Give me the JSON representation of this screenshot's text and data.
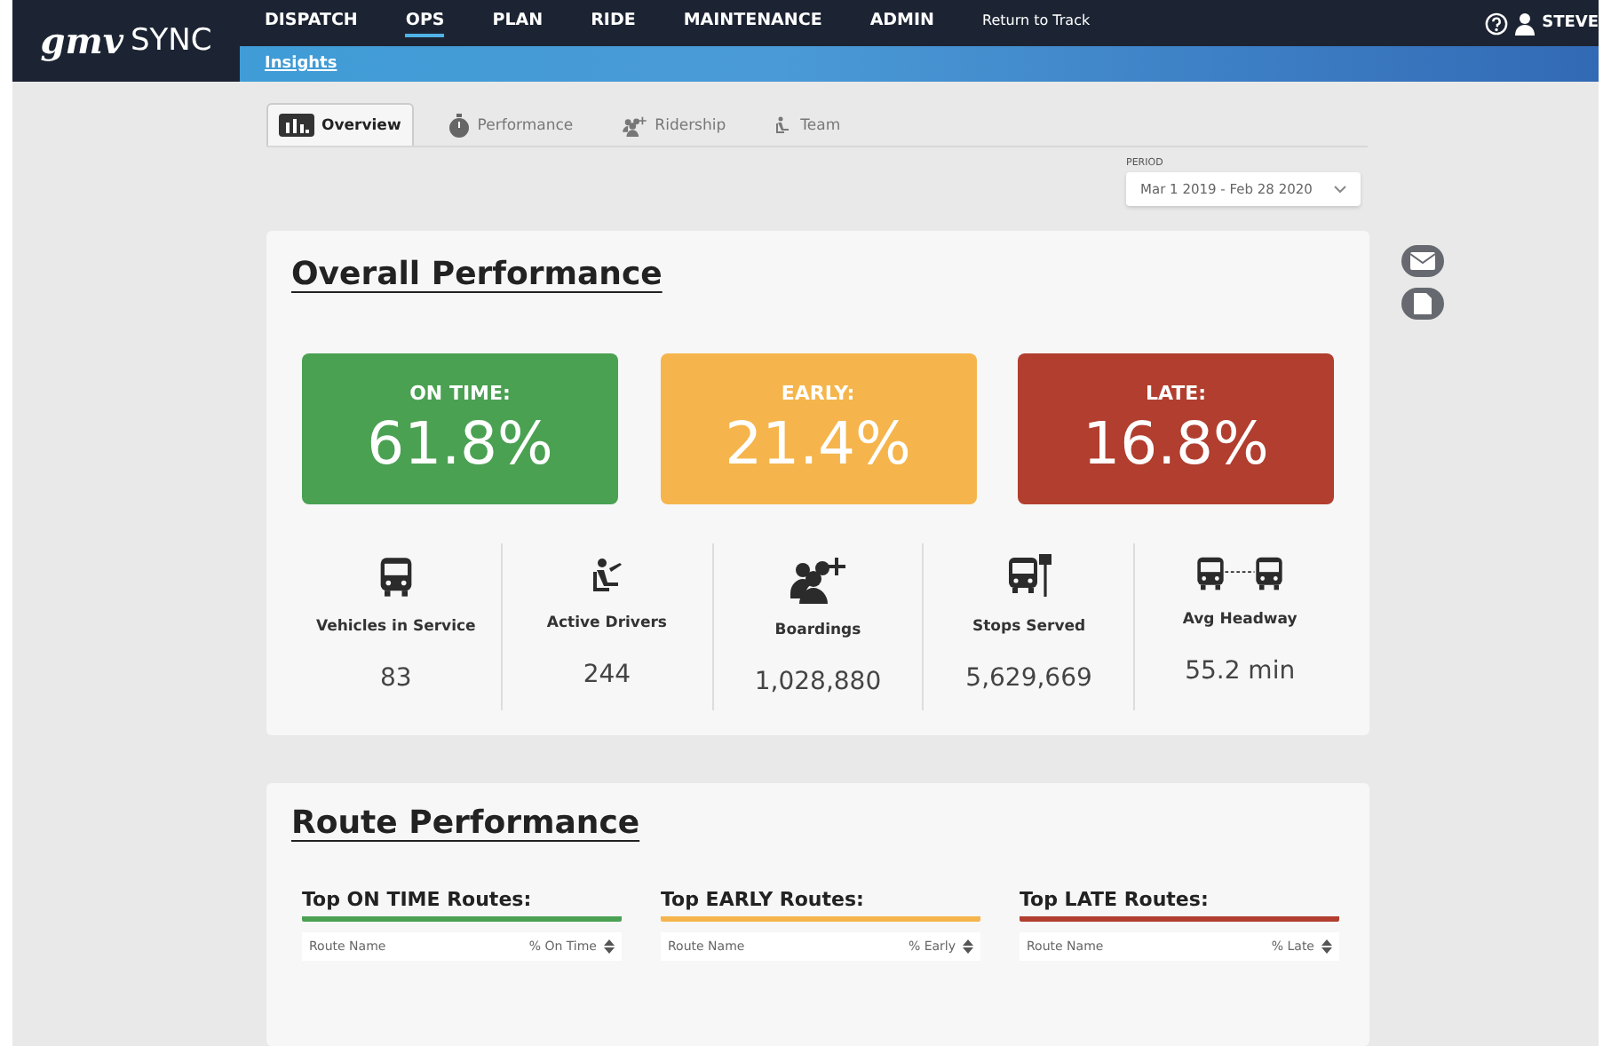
{
  "header": {
    "logo_mark": "gmv",
    "logo_text": "SYNC",
    "nav": [
      {
        "label": "DISPATCH",
        "selected": false,
        "kind": "main"
      },
      {
        "label": "OPS",
        "selected": true,
        "kind": "main"
      },
      {
        "label": "PLAN",
        "selected": false,
        "kind": "main"
      },
      {
        "label": "RIDE",
        "selected": false,
        "kind": "main"
      },
      {
        "label": "MAINTENANCE",
        "selected": false,
        "kind": "main"
      },
      {
        "label": "ADMIN",
        "selected": false,
        "kind": "main"
      },
      {
        "label": "Return to Track",
        "selected": false,
        "kind": "link"
      }
    ],
    "user": "STEVE",
    "subnav": "Insights"
  },
  "tabs": [
    {
      "label": "Overview",
      "selected": true,
      "kind": "chart"
    },
    {
      "label": "Performance",
      "selected": false,
      "kind": "stopwatch"
    },
    {
      "label": "Ridership",
      "selected": false,
      "kind": "people"
    },
    {
      "label": "Team",
      "selected": false,
      "kind": "driver"
    }
  ],
  "period": {
    "label": "PERIOD",
    "value": "Mar 1 2019 - Feb 28 2020"
  },
  "overall": {
    "title": "Overall Performance",
    "tiles": [
      {
        "label": "ON TIME:",
        "value": "61.8%",
        "color": "#4aa152"
      },
      {
        "label": "EARLY:",
        "value": "21.4%",
        "color": "#f5b54c"
      },
      {
        "label": "LATE:",
        "value": "16.8%",
        "color": "#b13e2f"
      }
    ],
    "stats": [
      {
        "kind": "bus",
        "label": "Vehicles in Service",
        "value": "83"
      },
      {
        "kind": "driver",
        "label": "Active Drivers",
        "value": "244"
      },
      {
        "kind": "people",
        "label": "Boardings",
        "value": "1,028,880"
      },
      {
        "kind": "stop",
        "label": "Stops Served",
        "value": "5,629,669"
      },
      {
        "kind": "headway",
        "label": "Avg Headway",
        "value": "55.2 min"
      }
    ]
  },
  "route": {
    "title": "Route Performance",
    "tables": [
      {
        "title": "Top ON TIME Routes:",
        "color": "#4aa152",
        "columns": [
          "Route Name",
          "% On Time"
        ]
      },
      {
        "title": "Top EARLY Routes:",
        "color": "#f5b54c",
        "columns": [
          "Route Name",
          "% Early"
        ]
      },
      {
        "title": "Top LATE Routes:",
        "color": "#b13e2f",
        "columns": [
          "Route Name",
          "% Late"
        ]
      }
    ]
  }
}
